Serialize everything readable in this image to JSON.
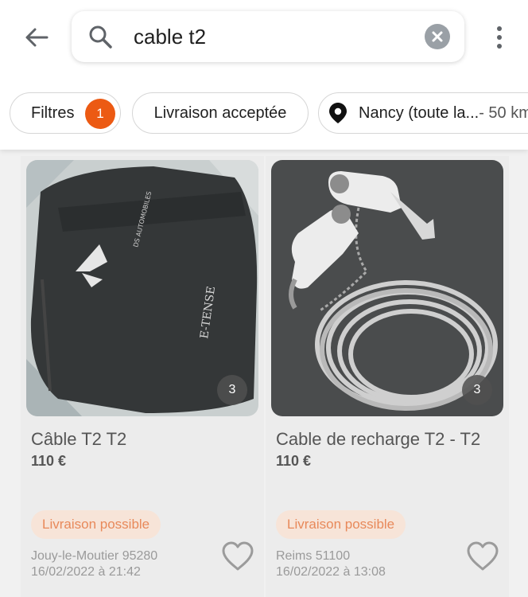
{
  "search": {
    "query": "cable t2"
  },
  "chips": {
    "filters_label": "Filtres",
    "filters_count": "1",
    "delivery_label": "Livraison acceptée",
    "location_label": "Nancy (toute la...",
    "location_distance": " - 50 km"
  },
  "listings": [
    {
      "title": "Câble T2 T2",
      "price": "110 €",
      "photo_count": "3",
      "delivery_tag": "Livraison possible",
      "location": "Jouy-le-Moutier 95280",
      "date": "16/02/2022 à 21:42"
    },
    {
      "title": "Cable de recharge T2 - T2",
      "price": "110 €",
      "photo_count": "3",
      "delivery_tag": "Livraison possible",
      "location": "Reims 51100",
      "date": "16/02/2022 à 13:08"
    }
  ],
  "photo_text": {
    "brand_vertical": "DS AUTOMOBILES",
    "product_mark": "E-TENSE"
  },
  "colors": {
    "accent": "#ec5a13",
    "delivery_bg": "#f7e4d8",
    "delivery_text": "#e8895a"
  },
  "icons": [
    "back-arrow-icon",
    "search-icon",
    "clear-icon",
    "more-vert-icon",
    "location-pin-icon",
    "heart-icon"
  ]
}
